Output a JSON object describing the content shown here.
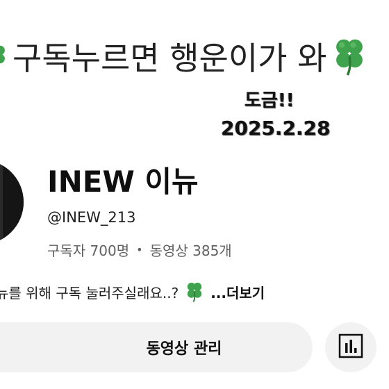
{
  "banner": {
    "slogan": "구독누르면 행운이가 와",
    "subtitle": "도금!!",
    "date": "2025.2.28"
  },
  "channel": {
    "name": "INEW 이뉴",
    "handle": "@INEW_213",
    "subscribers": "구독자 700명",
    "separator": "•",
    "videos": "동영상 385개",
    "description": "뉴를 위해 구독 눌러주실래요..?",
    "more_label": "...더보기"
  },
  "actions": {
    "manage_videos_label": "동영상 관리",
    "analytics_icon": "analytics-icon"
  },
  "colors": {
    "clover": "#3fa34d",
    "button_bg": "#f2f2f2",
    "secondary_text": "#606060"
  }
}
